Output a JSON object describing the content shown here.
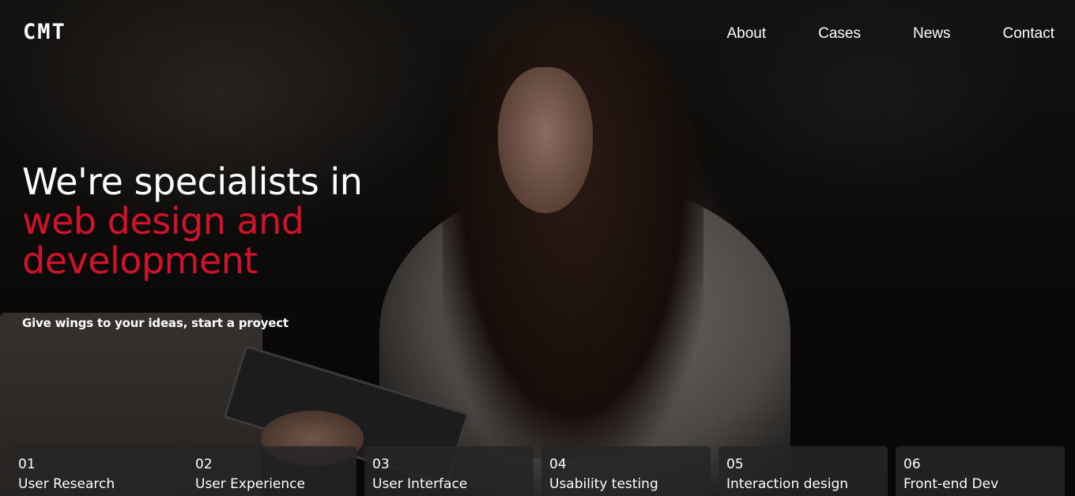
{
  "brand": {
    "logo_text": "CMT"
  },
  "nav": {
    "items": [
      {
        "label": "About"
      },
      {
        "label": "Cases"
      },
      {
        "label": "News"
      },
      {
        "label": "Contact"
      }
    ]
  },
  "hero": {
    "headline_line1": "We're specialists in",
    "headline_line2": "web design and",
    "headline_line3": "development",
    "tagline": "Give wings to your ideas, start a proyect"
  },
  "colors": {
    "accent": "#d0132a",
    "text": "#ffffff",
    "card_bg": "#262626"
  },
  "services": [
    {
      "number": "01",
      "label": "User Research"
    },
    {
      "number": "02",
      "label": "User Experience"
    },
    {
      "number": "03",
      "label": "User Interface"
    },
    {
      "number": "04",
      "label": "Usability testing"
    },
    {
      "number": "05",
      "label": "Interaction design"
    },
    {
      "number": "06",
      "label": "Front-end Dev"
    }
  ]
}
